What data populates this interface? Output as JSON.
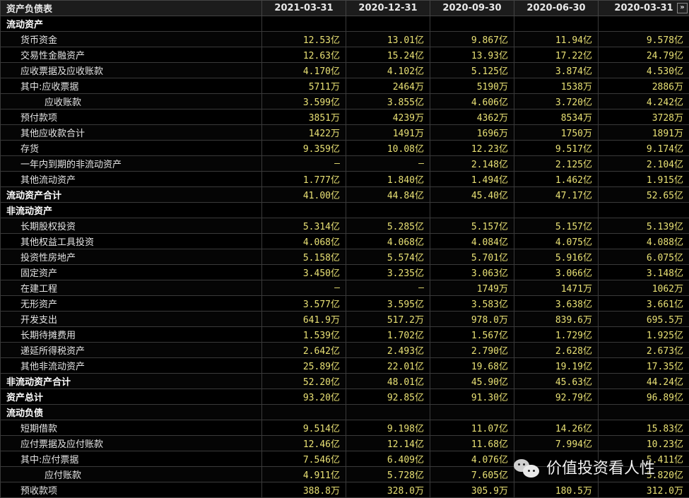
{
  "table": {
    "title": "资产负债表",
    "dates": [
      "2021-03-31",
      "2020-12-31",
      "2020-09-30",
      "2020-06-30",
      "2020-03-31"
    ],
    "scroll_button": "»",
    "rows": [
      {
        "label": "流动资产",
        "level": 0,
        "values": [
          "",
          "",
          "",
          "",
          ""
        ]
      },
      {
        "label": "货币资金",
        "level": 1,
        "values": [
          "12.53亿",
          "13.01亿",
          "9.867亿",
          "11.94亿",
          "9.578亿"
        ]
      },
      {
        "label": "交易性金融资产",
        "level": 1,
        "values": [
          "12.63亿",
          "15.24亿",
          "13.93亿",
          "17.22亿",
          "24.79亿"
        ]
      },
      {
        "label": "应收票据及应收账款",
        "level": 1,
        "values": [
          "4.170亿",
          "4.102亿",
          "5.125亿",
          "3.874亿",
          "4.530亿"
        ]
      },
      {
        "label": "其中:应收票据",
        "level": 1,
        "values": [
          "5711万",
          "2464万",
          "5190万",
          "1538万",
          "2886万"
        ]
      },
      {
        "label": "应收账款",
        "level": 2,
        "values": [
          "3.599亿",
          "3.855亿",
          "4.606亿",
          "3.720亿",
          "4.242亿"
        ]
      },
      {
        "label": "预付款项",
        "level": 1,
        "values": [
          "3851万",
          "4239万",
          "4362万",
          "8534万",
          "3728万"
        ]
      },
      {
        "label": "其他应收款合计",
        "level": 1,
        "values": [
          "1422万",
          "1491万",
          "1696万",
          "1750万",
          "1891万"
        ]
      },
      {
        "label": "存货",
        "level": 1,
        "values": [
          "9.359亿",
          "10.08亿",
          "12.23亿",
          "9.517亿",
          "9.174亿"
        ]
      },
      {
        "label": "一年内到期的非流动资产",
        "level": 1,
        "values": [
          "—",
          "—",
          "2.148亿",
          "2.125亿",
          "2.104亿"
        ]
      },
      {
        "label": "其他流动资产",
        "level": 1,
        "values": [
          "1.777亿",
          "1.840亿",
          "1.494亿",
          "1.462亿",
          "1.915亿"
        ]
      },
      {
        "label": "流动资产合计",
        "level": 0,
        "values": [
          "41.00亿",
          "44.84亿",
          "45.40亿",
          "47.17亿",
          "52.65亿"
        ]
      },
      {
        "label": "非流动资产",
        "level": 0,
        "values": [
          "",
          "",
          "",
          "",
          ""
        ]
      },
      {
        "label": "长期股权投资",
        "level": 1,
        "values": [
          "5.314亿",
          "5.285亿",
          "5.157亿",
          "5.157亿",
          "5.139亿"
        ]
      },
      {
        "label": "其他权益工具投资",
        "level": 1,
        "values": [
          "4.068亿",
          "4.068亿",
          "4.084亿",
          "4.075亿",
          "4.088亿"
        ]
      },
      {
        "label": "投资性房地产",
        "level": 1,
        "values": [
          "5.158亿",
          "5.574亿",
          "5.701亿",
          "5.916亿",
          "6.075亿"
        ]
      },
      {
        "label": "固定资产",
        "level": 1,
        "values": [
          "3.450亿",
          "3.235亿",
          "3.063亿",
          "3.066亿",
          "3.148亿"
        ]
      },
      {
        "label": "在建工程",
        "level": 1,
        "values": [
          "—",
          "—",
          "1749万",
          "1471万",
          "1062万"
        ]
      },
      {
        "label": "无形资产",
        "level": 1,
        "values": [
          "3.577亿",
          "3.595亿",
          "3.583亿",
          "3.638亿",
          "3.661亿"
        ]
      },
      {
        "label": "开发支出",
        "level": 1,
        "values": [
          "641.9万",
          "517.2万",
          "978.0万",
          "839.6万",
          "695.5万"
        ]
      },
      {
        "label": "长期待摊费用",
        "level": 1,
        "values": [
          "1.539亿",
          "1.702亿",
          "1.567亿",
          "1.729亿",
          "1.925亿"
        ]
      },
      {
        "label": "递延所得税资产",
        "level": 1,
        "values": [
          "2.642亿",
          "2.493亿",
          "2.790亿",
          "2.628亿",
          "2.673亿"
        ]
      },
      {
        "label": "其他非流动资产",
        "level": 1,
        "values": [
          "25.89亿",
          "22.01亿",
          "19.68亿",
          "19.19亿",
          "17.35亿"
        ]
      },
      {
        "label": "非流动资产合计",
        "level": 0,
        "values": [
          "52.20亿",
          "48.01亿",
          "45.90亿",
          "45.63亿",
          "44.24亿"
        ]
      },
      {
        "label": "资产总计",
        "level": 0,
        "values": [
          "93.20亿",
          "92.85亿",
          "91.30亿",
          "92.79亿",
          "96.89亿"
        ]
      },
      {
        "label": "流动负债",
        "level": 0,
        "values": [
          "",
          "",
          "",
          "",
          ""
        ]
      },
      {
        "label": "短期借款",
        "level": 1,
        "values": [
          "9.514亿",
          "9.198亿",
          "11.07亿",
          "14.26亿",
          "15.83亿"
        ]
      },
      {
        "label": "应付票据及应付账款",
        "level": 1,
        "values": [
          "12.46亿",
          "12.14亿",
          "11.68亿",
          "7.994亿",
          "10.23亿"
        ]
      },
      {
        "label": "其中:应付票据",
        "level": 1,
        "values": [
          "7.546亿",
          "6.409亿",
          "4.076亿",
          "",
          "5.411亿"
        ]
      },
      {
        "label": "应付账款",
        "level": 2,
        "values": [
          "4.911亿",
          "5.728亿",
          "7.605亿",
          "",
          "5.820亿"
        ]
      },
      {
        "label": "预收款项",
        "level": 1,
        "values": [
          "388.8万",
          "328.0万",
          "305.9万",
          "180.5万",
          "312.0万"
        ]
      }
    ]
  },
  "watermark": {
    "text": "价值投资看人性",
    "icon": "wechat-icon"
  },
  "colors": {
    "background": "#000000",
    "value_text": "#e8e074",
    "label_text": "#e4e4e4",
    "header_bg": "#1c1c1c",
    "grid": "#3a3a3a"
  }
}
